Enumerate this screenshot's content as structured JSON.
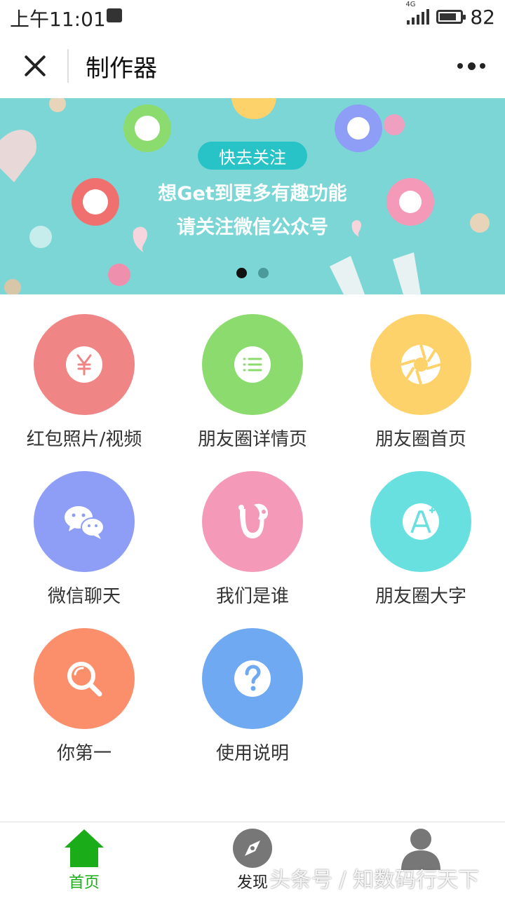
{
  "status": {
    "time": "上午11:01",
    "network": "4G",
    "battery": "82",
    "battery_level": 0.82
  },
  "header": {
    "title": "制作器"
  },
  "banner": {
    "badge": "快去关注",
    "line1": "想Get到更多有趣功能",
    "line2": "请关注微信公众号",
    "page_count": 2,
    "active_page": 1
  },
  "grid": {
    "items": [
      {
        "label": "红包照片/视频",
        "color": "#f08585",
        "icon": "yen-icon"
      },
      {
        "label": "朋友圈详情页",
        "color": "#8cdb6e",
        "icon": "list-icon"
      },
      {
        "label": "朋友圈首页",
        "color": "#fdd26a",
        "icon": "aperture-icon"
      },
      {
        "label": "微信聊天",
        "color": "#8e9df5",
        "icon": "wechat-icon"
      },
      {
        "label": "我们是谁",
        "color": "#f49ab8",
        "icon": "mascot-icon"
      },
      {
        "label": "朋友圈大字",
        "color": "#69e0e0",
        "icon": "font-plus-icon"
      },
      {
        "label": "你第一",
        "color": "#fb8f6c",
        "icon": "search-icon"
      },
      {
        "label": "使用说明",
        "color": "#6fa9f2",
        "icon": "question-icon"
      }
    ]
  },
  "tabbar": {
    "items": [
      {
        "label": "首页",
        "icon": "home-icon",
        "active": true
      },
      {
        "label": "发现",
        "icon": "compass-icon",
        "active": false
      },
      {
        "label": "",
        "icon": "profile-icon",
        "active": false
      }
    ]
  },
  "watermark": "头条号 / 知数码行天下",
  "colors": {
    "accent": "#1aad19",
    "banner_bg": "#7dd6d6"
  }
}
